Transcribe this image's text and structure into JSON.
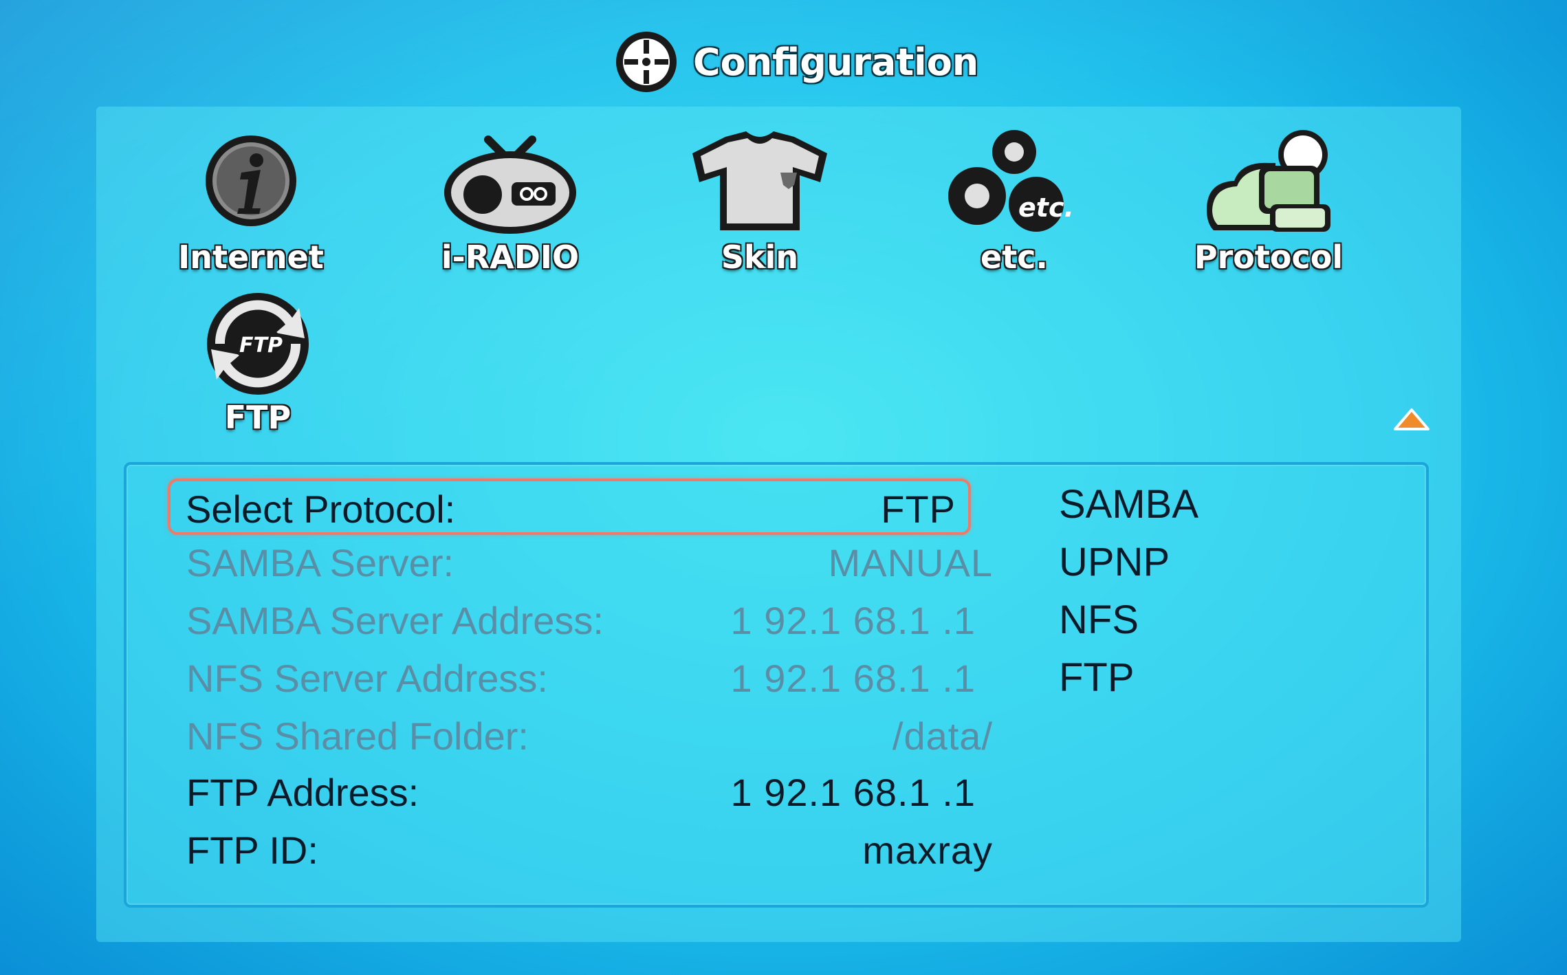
{
  "header": {
    "title": "Configuration",
    "icon": "crosshair-settings-icon"
  },
  "menu": {
    "items": [
      {
        "label": "Internet",
        "icon": "info-icon"
      },
      {
        "label": "i-RADIO",
        "icon": "radio-icon"
      },
      {
        "label": "Skin",
        "icon": "tshirt-icon"
      },
      {
        "label": "etc.",
        "icon": "etc-circles-icon"
      },
      {
        "label": "Protocol",
        "icon": "protocol-cloud-icon"
      },
      {
        "label": "FTP",
        "icon": "ftp-sync-icon"
      }
    ],
    "scroll_up_icon": "triangle-up-icon"
  },
  "settings": {
    "rows": [
      {
        "label": "Select Protocol:",
        "value": "FTP",
        "state": "selected"
      },
      {
        "label": "SAMBA Server:",
        "value": "MANUAL",
        "state": "disabled"
      },
      {
        "label": "SAMBA Server  Address:",
        "value": "1 92.1 68.1 .1",
        "state": "disabled"
      },
      {
        "label": "NFS Server  Address:",
        "value": "1 92.1 68.1 .1",
        "state": "disabled"
      },
      {
        "label": "NFS Shared Folder:",
        "value": "/data/",
        "state": "disabled"
      },
      {
        "label": "FTP Address:",
        "value": "1 92.1 68.1 .1",
        "state": "enabled"
      },
      {
        "label": "FTP ID:",
        "value": "maxray",
        "state": "enabled"
      }
    ],
    "options": [
      "SAMBA",
      "UPNP",
      "NFS",
      "FTP"
    ]
  },
  "colors": {
    "background": "#1cc0ec",
    "selection_border": "#f07a6a",
    "text_enabled": "#0b1a28",
    "text_disabled": "#5a8ea6"
  }
}
